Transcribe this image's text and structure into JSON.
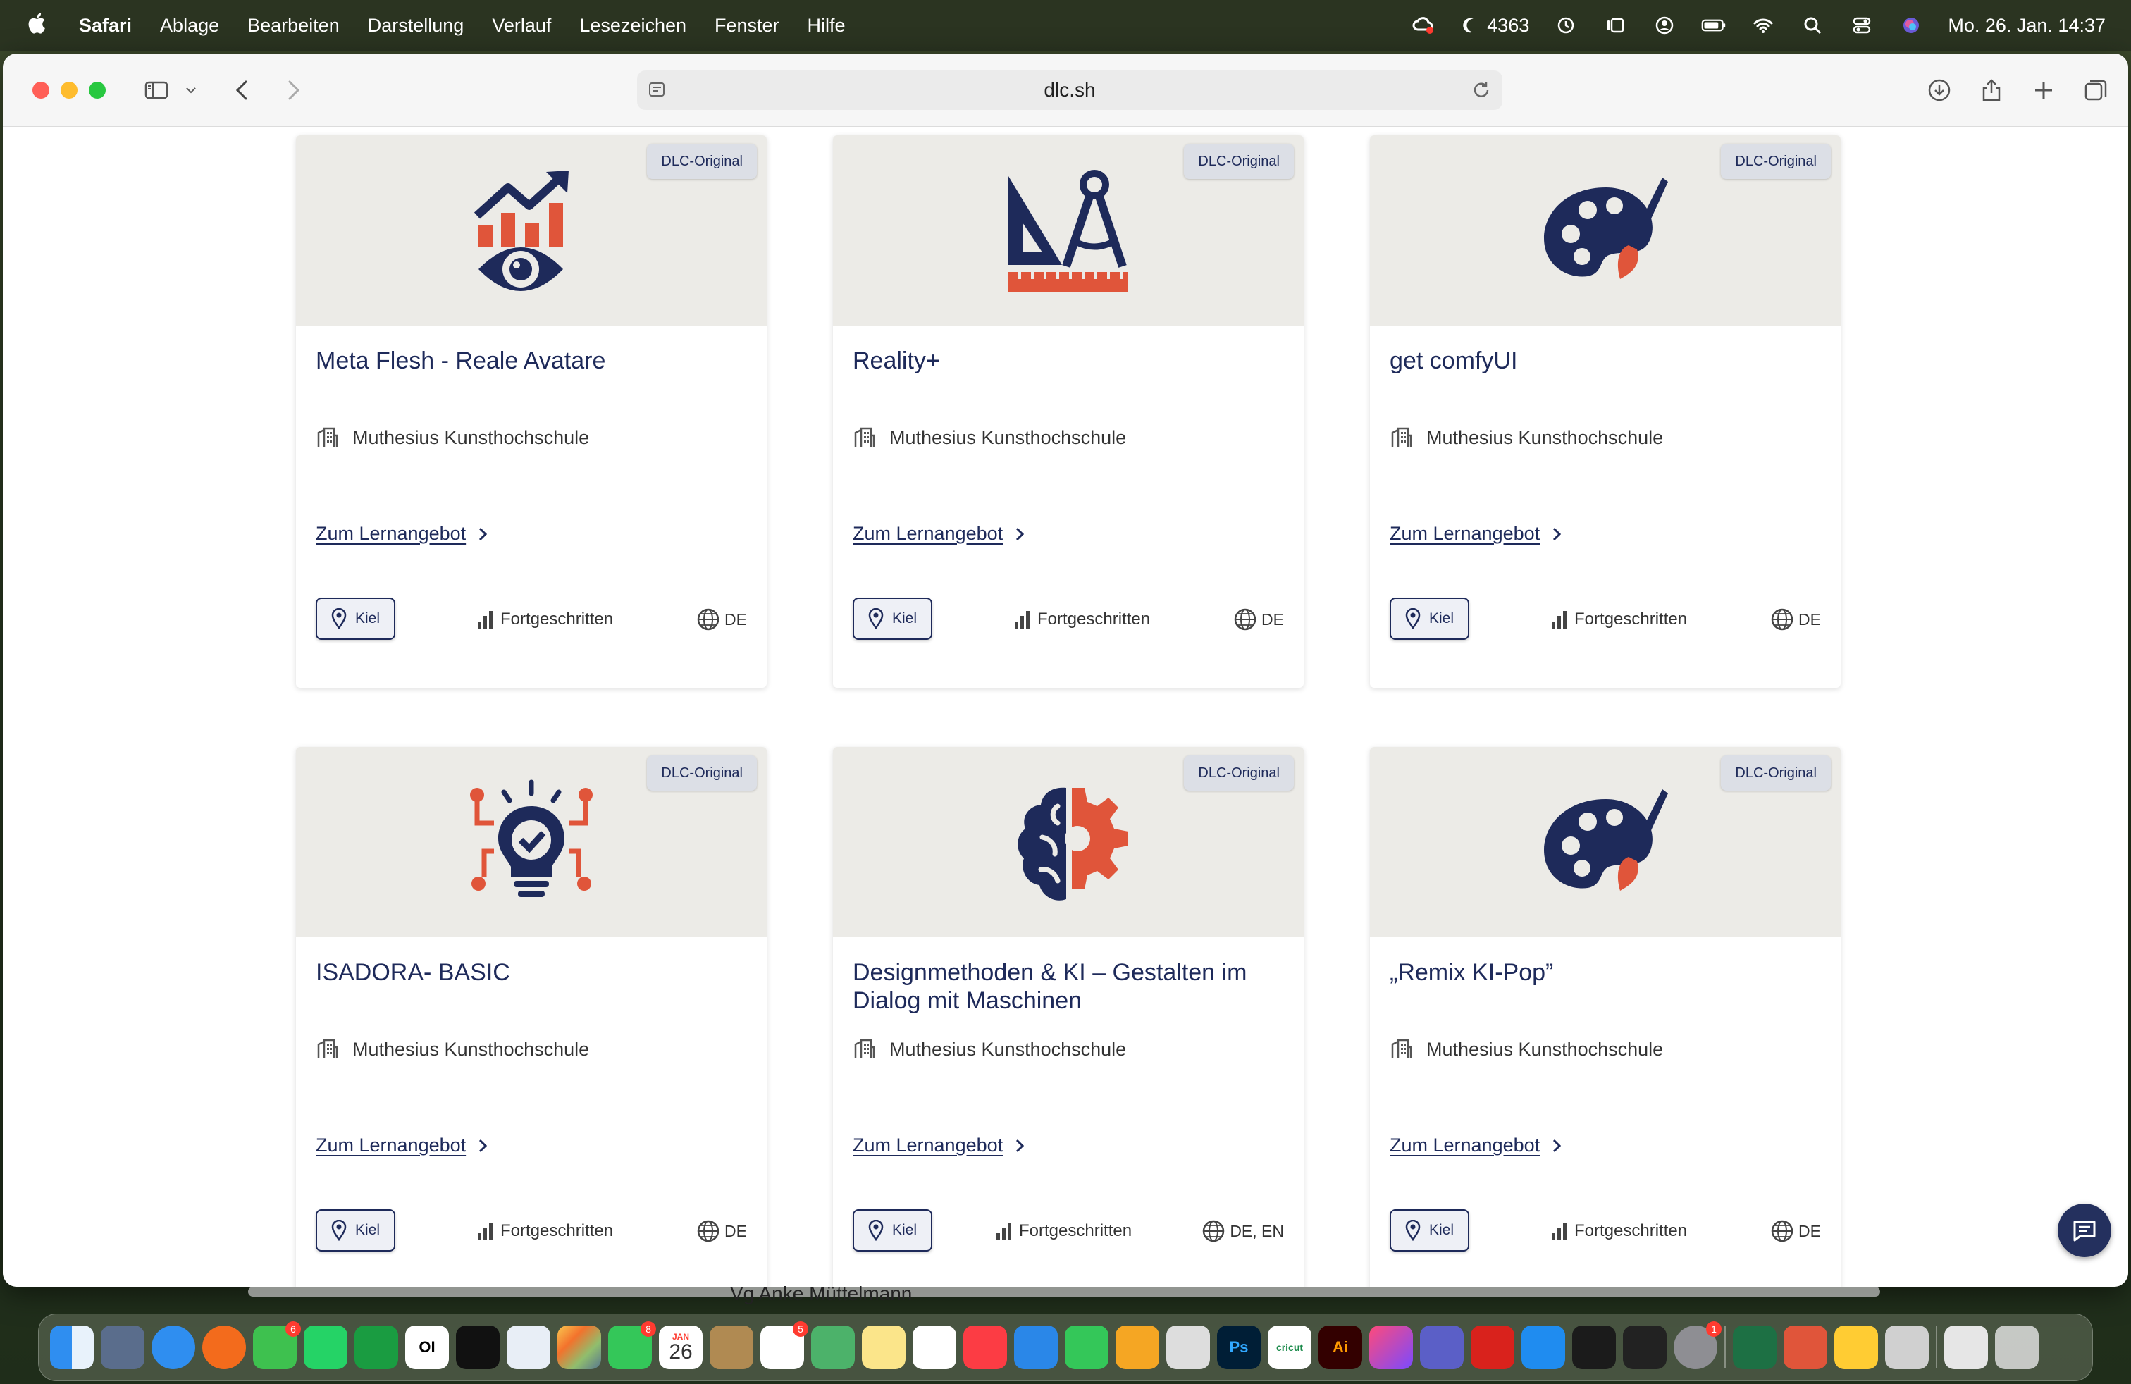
{
  "menubar": {
    "app": "Safari",
    "items": [
      "Ablage",
      "Bearbeiten",
      "Darstellung",
      "Verlauf",
      "Lesezeichen",
      "Fenster",
      "Hilfe"
    ],
    "battery_count": "4363",
    "datetime": "Mo. 26. Jan. 14:37"
  },
  "browser": {
    "url": "dlc.sh"
  },
  "cards": [
    {
      "badge": "DLC-Original",
      "title": "Meta Flesh - Reale Avatare",
      "org": "Muthesius Kunsthochschule",
      "link": "Zum Lernangebot",
      "location": "Kiel",
      "level": "Fortgeschritten",
      "lang": "DE",
      "icon": "chart-eye-icon"
    },
    {
      "badge": "DLC-Original",
      "title": "Reality+",
      "org": "Muthesius Kunsthochschule",
      "link": "Zum Lernangebot",
      "location": "Kiel",
      "level": "Fortgeschritten",
      "lang": "DE",
      "icon": "drafting-tools-icon"
    },
    {
      "badge": "DLC-Original",
      "title": "get comfyUI",
      "org": "Muthesius Kunsthochschule",
      "link": "Zum Lernangebot",
      "location": "Kiel",
      "level": "Fortgeschritten",
      "lang": "DE",
      "icon": "palette-icon"
    },
    {
      "badge": "DLC-Original",
      "title": "ISADORA- BASIC",
      "org": "Muthesius Kunsthochschule",
      "link": "Zum Lernangebot",
      "location": "Kiel",
      "level": "Fortgeschritten",
      "lang": "DE",
      "icon": "lightbulb-circuit-icon"
    },
    {
      "badge": "DLC-Original",
      "title": "Designmethoden & KI – Gestalten im Dialog mit Maschinen",
      "org": "Muthesius Kunsthochschule",
      "link": "Zum Lernangebot",
      "location": "Kiel",
      "level": "Fortgeschritten",
      "lang": "DE, EN",
      "icon": "brain-gear-icon"
    },
    {
      "badge": "DLC-Original",
      "title": "„Remix KI-Pop”",
      "org": "Muthesius Kunsthochschule",
      "link": "Zum Lernangebot",
      "location": "Kiel",
      "level": "Fortgeschritten",
      "lang": "DE",
      "icon": "palette-icon"
    }
  ],
  "peek_text": "Vg Anke Müttelmann",
  "dock": {
    "calendar_month": "JAN",
    "calendar_day": "26",
    "badge_messages": "6",
    "badge_facetime": "8",
    "badge_reminders": "5",
    "badge_settings": "1",
    "label_oi": "OI",
    "label_ps": "Ps",
    "label_ai": "Ai",
    "label_cricut": "cricut"
  },
  "colors": {
    "navy": "#1e2a5a",
    "orange": "#e0553a",
    "card_media_bg": "#ecebe7"
  }
}
